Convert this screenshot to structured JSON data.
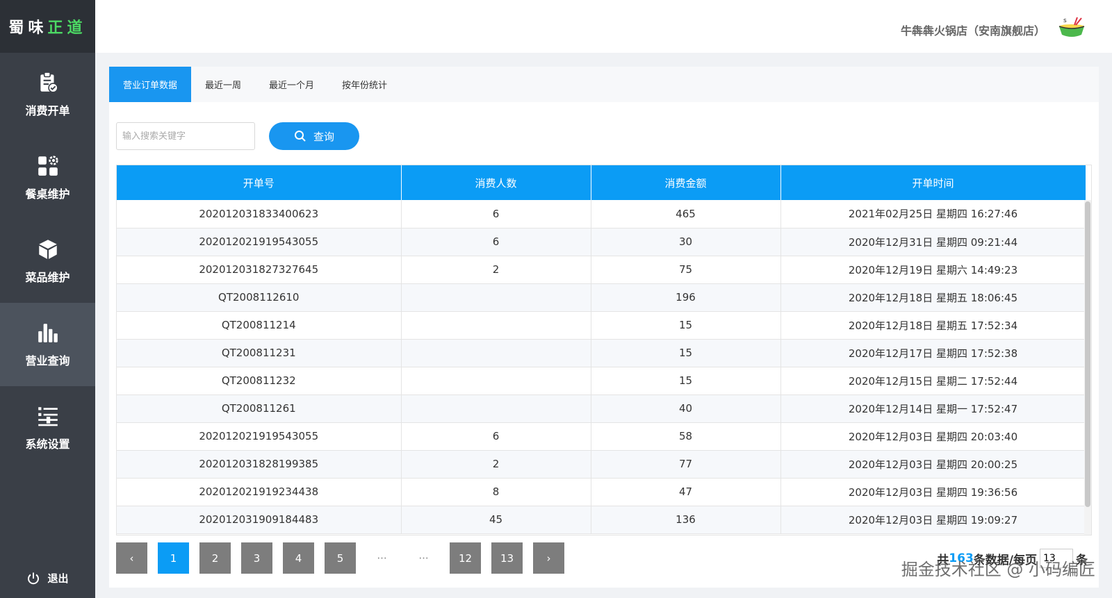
{
  "brand": {
    "part1": "蜀味",
    "part2": "正道"
  },
  "sidebar": {
    "items": [
      {
        "label": "消费开单",
        "icon": "clipboard-check-icon"
      },
      {
        "label": "餐桌维护",
        "icon": "grid-gear-icon"
      },
      {
        "label": "菜品维护",
        "icon": "cube-icon"
      },
      {
        "label": "营业查询",
        "icon": "bar-chart-icon"
      },
      {
        "label": "系统设置",
        "icon": "settings-list-icon"
      }
    ],
    "active_index": 3,
    "logout_label": "退出"
  },
  "header": {
    "store_name": "牛犇犇火锅店（安南旗舰店）"
  },
  "tabs": [
    "营业订单数据",
    "最近一周",
    "最近一个月",
    "按年份统计"
  ],
  "search": {
    "placeholder": "输入搜索关键字",
    "button_label": "查询"
  },
  "table": {
    "columns": [
      "开单号",
      "消费人数",
      "消费金额",
      "开单时间"
    ],
    "rows": [
      [
        "202012031833400623",
        "6",
        "465",
        "2021年02月25日 星期四 16:27:46"
      ],
      [
        "202012021919543055",
        "6",
        "30",
        "2020年12月31日 星期四 09:21:44"
      ],
      [
        "202012031827327645",
        "2",
        "75",
        "2020年12月19日 星期六 14:49:23"
      ],
      [
        "QT2008112610",
        "",
        "196",
        "2020年12月18日 星期五 18:06:45"
      ],
      [
        "QT200811214",
        "",
        "15",
        "2020年12月18日 星期五 17:52:34"
      ],
      [
        "QT200811231",
        "",
        "15",
        "2020年12月17日 星期四 17:52:38"
      ],
      [
        "QT200811232",
        "",
        "15",
        "2020年12月15日 星期二 17:52:44"
      ],
      [
        "QT200811261",
        "",
        "40",
        "2020年12月14日 星期一 17:52:47"
      ],
      [
        "202012021919543055",
        "6",
        "58",
        "2020年12月03日 星期四 20:03:40"
      ],
      [
        "202012031828199385",
        "2",
        "77",
        "2020年12月03日 星期四 20:00:25"
      ],
      [
        "202012021919234438",
        "8",
        "47",
        "2020年12月03日 星期四 19:36:56"
      ],
      [
        "202012031909184483",
        "45",
        "136",
        "2020年12月03日 星期四 19:09:27"
      ]
    ]
  },
  "pagination": {
    "prev": "‹",
    "pages": [
      "1",
      "2",
      "3",
      "4",
      "5",
      "···",
      "···",
      "12",
      "13"
    ],
    "current": "1",
    "next": "›",
    "total_prefix": "共",
    "total": "163",
    "total_suffix": "条数据/每页",
    "page_size": "13",
    "page_size_suffix": "条"
  },
  "watermark": "掘金技术社区 @ 小码编匠",
  "colors": {
    "accent": "#0b9cf5",
    "sidebar": "#3a3f47",
    "brand_green": "#4cd964"
  }
}
